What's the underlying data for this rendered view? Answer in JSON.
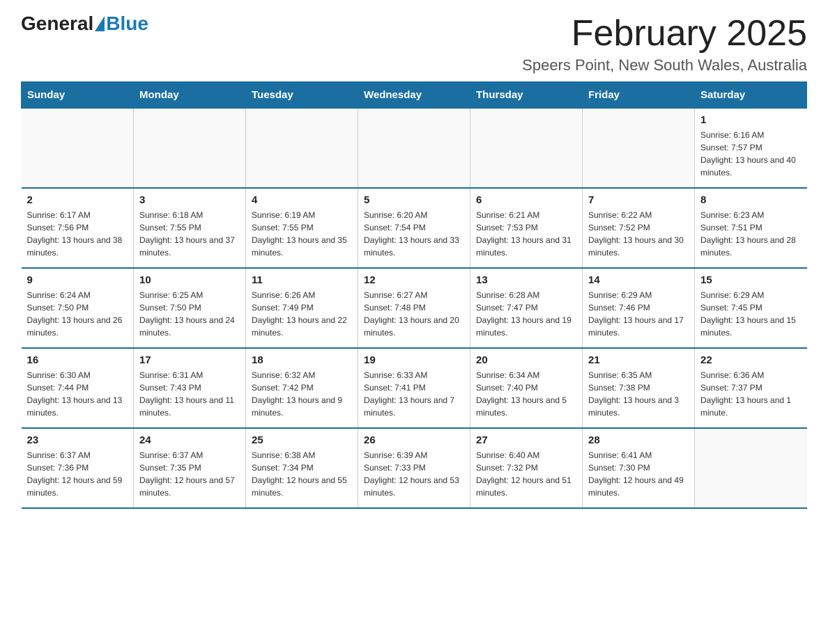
{
  "logo": {
    "general": "General",
    "blue": "Blue"
  },
  "title": "February 2025",
  "subtitle": "Speers Point, New South Wales, Australia",
  "days_of_week": [
    "Sunday",
    "Monday",
    "Tuesday",
    "Wednesday",
    "Thursday",
    "Friday",
    "Saturday"
  ],
  "weeks": [
    [
      {
        "day": "",
        "info": ""
      },
      {
        "day": "",
        "info": ""
      },
      {
        "day": "",
        "info": ""
      },
      {
        "day": "",
        "info": ""
      },
      {
        "day": "",
        "info": ""
      },
      {
        "day": "",
        "info": ""
      },
      {
        "day": "1",
        "info": "Sunrise: 6:16 AM\nSunset: 7:57 PM\nDaylight: 13 hours and 40 minutes."
      }
    ],
    [
      {
        "day": "2",
        "info": "Sunrise: 6:17 AM\nSunset: 7:56 PM\nDaylight: 13 hours and 38 minutes."
      },
      {
        "day": "3",
        "info": "Sunrise: 6:18 AM\nSunset: 7:55 PM\nDaylight: 13 hours and 37 minutes."
      },
      {
        "day": "4",
        "info": "Sunrise: 6:19 AM\nSunset: 7:55 PM\nDaylight: 13 hours and 35 minutes."
      },
      {
        "day": "5",
        "info": "Sunrise: 6:20 AM\nSunset: 7:54 PM\nDaylight: 13 hours and 33 minutes."
      },
      {
        "day": "6",
        "info": "Sunrise: 6:21 AM\nSunset: 7:53 PM\nDaylight: 13 hours and 31 minutes."
      },
      {
        "day": "7",
        "info": "Sunrise: 6:22 AM\nSunset: 7:52 PM\nDaylight: 13 hours and 30 minutes."
      },
      {
        "day": "8",
        "info": "Sunrise: 6:23 AM\nSunset: 7:51 PM\nDaylight: 13 hours and 28 minutes."
      }
    ],
    [
      {
        "day": "9",
        "info": "Sunrise: 6:24 AM\nSunset: 7:50 PM\nDaylight: 13 hours and 26 minutes."
      },
      {
        "day": "10",
        "info": "Sunrise: 6:25 AM\nSunset: 7:50 PM\nDaylight: 13 hours and 24 minutes."
      },
      {
        "day": "11",
        "info": "Sunrise: 6:26 AM\nSunset: 7:49 PM\nDaylight: 13 hours and 22 minutes."
      },
      {
        "day": "12",
        "info": "Sunrise: 6:27 AM\nSunset: 7:48 PM\nDaylight: 13 hours and 20 minutes."
      },
      {
        "day": "13",
        "info": "Sunrise: 6:28 AM\nSunset: 7:47 PM\nDaylight: 13 hours and 19 minutes."
      },
      {
        "day": "14",
        "info": "Sunrise: 6:29 AM\nSunset: 7:46 PM\nDaylight: 13 hours and 17 minutes."
      },
      {
        "day": "15",
        "info": "Sunrise: 6:29 AM\nSunset: 7:45 PM\nDaylight: 13 hours and 15 minutes."
      }
    ],
    [
      {
        "day": "16",
        "info": "Sunrise: 6:30 AM\nSunset: 7:44 PM\nDaylight: 13 hours and 13 minutes."
      },
      {
        "day": "17",
        "info": "Sunrise: 6:31 AM\nSunset: 7:43 PM\nDaylight: 13 hours and 11 minutes."
      },
      {
        "day": "18",
        "info": "Sunrise: 6:32 AM\nSunset: 7:42 PM\nDaylight: 13 hours and 9 minutes."
      },
      {
        "day": "19",
        "info": "Sunrise: 6:33 AM\nSunset: 7:41 PM\nDaylight: 13 hours and 7 minutes."
      },
      {
        "day": "20",
        "info": "Sunrise: 6:34 AM\nSunset: 7:40 PM\nDaylight: 13 hours and 5 minutes."
      },
      {
        "day": "21",
        "info": "Sunrise: 6:35 AM\nSunset: 7:38 PM\nDaylight: 13 hours and 3 minutes."
      },
      {
        "day": "22",
        "info": "Sunrise: 6:36 AM\nSunset: 7:37 PM\nDaylight: 13 hours and 1 minute."
      }
    ],
    [
      {
        "day": "23",
        "info": "Sunrise: 6:37 AM\nSunset: 7:36 PM\nDaylight: 12 hours and 59 minutes."
      },
      {
        "day": "24",
        "info": "Sunrise: 6:37 AM\nSunset: 7:35 PM\nDaylight: 12 hours and 57 minutes."
      },
      {
        "day": "25",
        "info": "Sunrise: 6:38 AM\nSunset: 7:34 PM\nDaylight: 12 hours and 55 minutes."
      },
      {
        "day": "26",
        "info": "Sunrise: 6:39 AM\nSunset: 7:33 PM\nDaylight: 12 hours and 53 minutes."
      },
      {
        "day": "27",
        "info": "Sunrise: 6:40 AM\nSunset: 7:32 PM\nDaylight: 12 hours and 51 minutes."
      },
      {
        "day": "28",
        "info": "Sunrise: 6:41 AM\nSunset: 7:30 PM\nDaylight: 12 hours and 49 minutes."
      },
      {
        "day": "",
        "info": ""
      }
    ]
  ]
}
